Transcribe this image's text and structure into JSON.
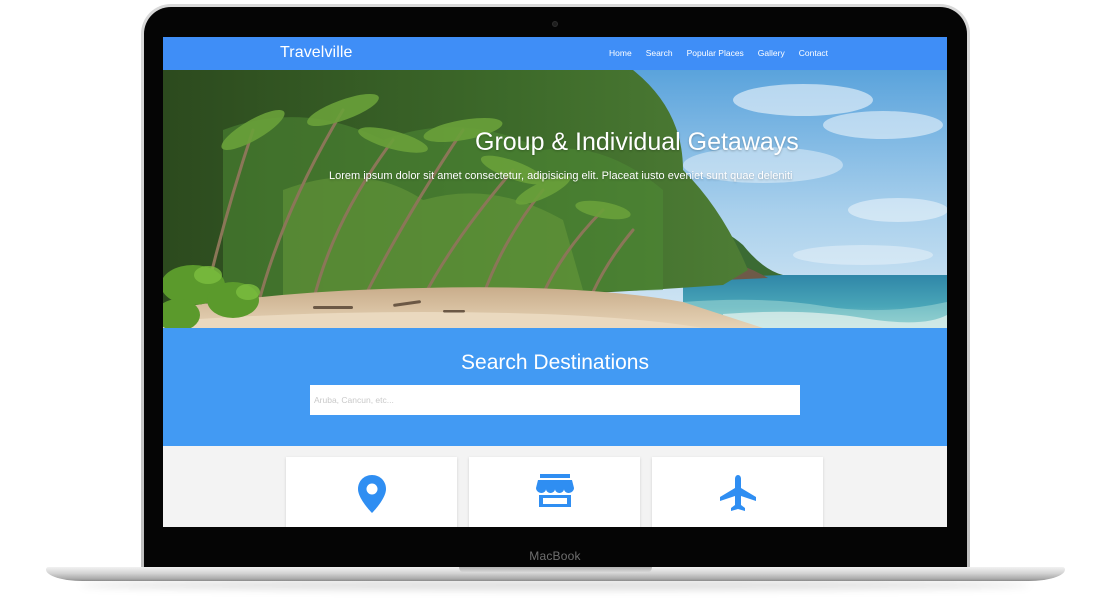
{
  "device": {
    "label": "MacBook"
  },
  "site": {
    "logo": "Travelville",
    "nav": [
      {
        "label": "Home"
      },
      {
        "label": "Search"
      },
      {
        "label": "Popular Places"
      },
      {
        "label": "Gallery"
      },
      {
        "label": "Contact"
      }
    ],
    "hero": {
      "title": "Group & Individual Getaways",
      "subtitle": "Lorem ipsum dolor sit amet consectetur, adipisicing elit. Placeat iusto eveniet sunt quae deleniti"
    },
    "search": {
      "title": "Search Destinations",
      "placeholder": "Aruba, Cancun, etc..."
    },
    "cards": [
      {
        "icon": "map-marker-icon"
      },
      {
        "icon": "store-icon"
      },
      {
        "icon": "plane-icon"
      }
    ]
  },
  "colors": {
    "navbar": "#3f8ef7",
    "search_band": "#429af3",
    "icon_blue": "#2f8ef2",
    "cards_bg": "#f3f3f3"
  }
}
